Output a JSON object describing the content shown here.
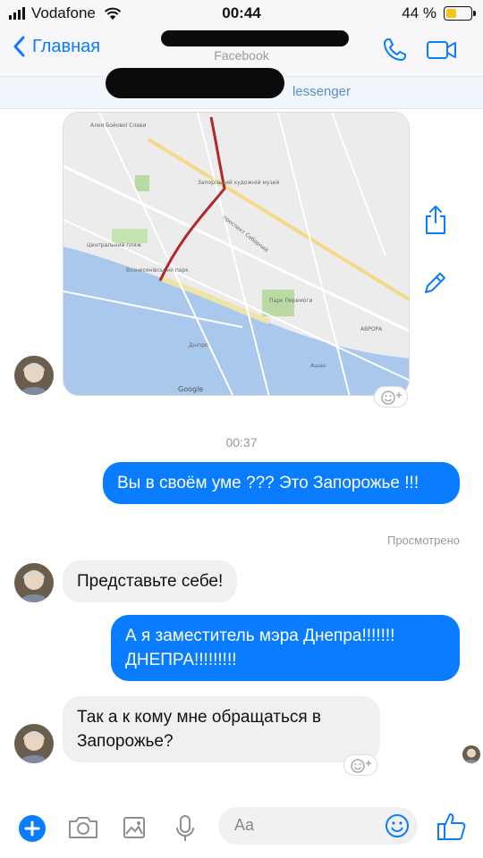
{
  "status": {
    "carrier": "Vodafone",
    "time": "00:44",
    "battery": "44 %",
    "battery_level": 0.44
  },
  "header": {
    "back_label": "Главная",
    "subtitle": "Facebook"
  },
  "banner": {
    "text": "lessenger"
  },
  "map": {
    "labels": {
      "google": "Google",
      "park": "Парк Перемоги",
      "beach": "Центральний пляж",
      "aurora": "АВРОРА",
      "auchan": "Ашан",
      "museum": "Запорізький художній музей",
      "alley": "Алея Бойової Слави",
      "park2": "Вознесенівський парк",
      "avenue": "проспект Соборний",
      "dnipro": "Дніпро"
    }
  },
  "chat": {
    "timestamp": "00:37",
    "messages": [
      {
        "type": "out",
        "text": "Вы в своём уме ??? Это Запорожье !!!"
      },
      {
        "type": "in",
        "text": "Представьте себе!"
      },
      {
        "type": "out",
        "text": "А я заместитель мэра Днепра!!!!!!! ДНЕПРА!!!!!!!!!"
      },
      {
        "type": "in",
        "text": "Так а к кому мне обращаться в Запорожье?"
      }
    ],
    "seen": "Просмотрено"
  },
  "composer": {
    "placeholder": "Aa"
  },
  "colors": {
    "accent": "#0a7cff",
    "incoming": "#f0f0f0",
    "bar": "#f7f7f9"
  }
}
